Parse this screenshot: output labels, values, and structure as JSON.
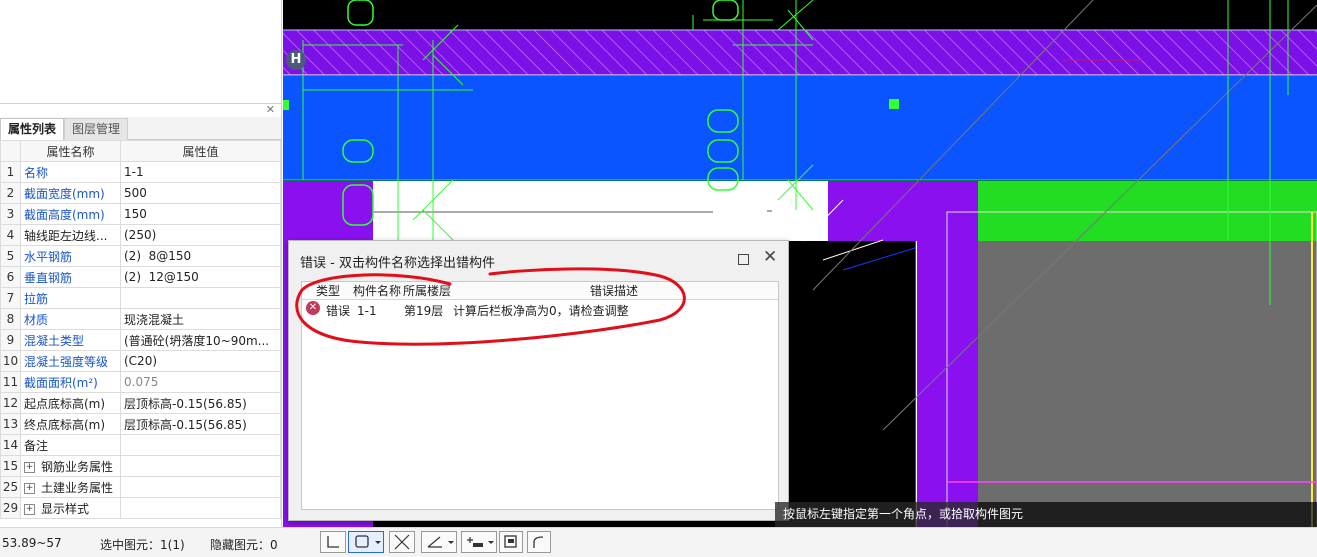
{
  "panel": {
    "tabs": [
      "属性列表",
      "图层管理"
    ],
    "columns": [
      "属性名称",
      "属性值"
    ],
    "rows": [
      {
        "num": "1",
        "name": "名称",
        "value": "1-1",
        "blue": true
      },
      {
        "num": "2",
        "name": "截面宽度(mm)",
        "value": "500",
        "blue": true
      },
      {
        "num": "3",
        "name": "截面高度(mm)",
        "value": "150",
        "blue": true
      },
      {
        "num": "4",
        "name": "轴线距左边线...",
        "value": "(250)",
        "blue": false
      },
      {
        "num": "5",
        "name": "水平钢筋",
        "value": "(2)  8@150",
        "blue": true
      },
      {
        "num": "6",
        "name": "垂直钢筋",
        "value": "(2)  12@150",
        "blue": true
      },
      {
        "num": "7",
        "name": "拉筋",
        "value": "",
        "blue": true
      },
      {
        "num": "8",
        "name": "材质",
        "value": "现浇混凝土",
        "blue": true
      },
      {
        "num": "9",
        "name": "混凝土类型",
        "value": "(普通砼(坍落度10~90m...",
        "blue": true
      },
      {
        "num": "10",
        "name": "混凝土强度等级",
        "value": "(C20)",
        "blue": true
      },
      {
        "num": "11",
        "name": "截面面积(m²)",
        "value": "0.075",
        "blue": true,
        "grayValue": true
      },
      {
        "num": "12",
        "name": "起点底标高(m)",
        "value": "层顶标高-0.15(56.85)",
        "blue": false
      },
      {
        "num": "13",
        "name": "终点底标高(m)",
        "value": "层顶标高-0.15(56.85)",
        "blue": false
      },
      {
        "num": "14",
        "name": "备注",
        "value": "",
        "blue": false
      },
      {
        "num": "15",
        "name": "钢筋业务属性",
        "value": "",
        "blue": false,
        "expander": true
      },
      {
        "num": "25",
        "name": "土建业务属性",
        "value": "",
        "blue": false,
        "expander": true
      },
      {
        "num": "29",
        "name": "显示样式",
        "value": "",
        "blue": false,
        "expander": true
      }
    ]
  },
  "canvas": {
    "marker": "H",
    "hint": "按鼠标左键指定第一个角点，或拾取构件图元"
  },
  "dialog": {
    "title": "错误 - 双击构件名称选择出错构件",
    "headers": {
      "type": "类型",
      "name": "构件名称",
      "floor": "所属楼层",
      "desc": "错误描述"
    },
    "row": {
      "type": "错误",
      "name": "1-1",
      "floor": "第19层",
      "desc": "计算后栏板净高为0，请检查调整"
    }
  },
  "status": {
    "coords": "53.89~57",
    "selected": "选中图元：1(1)",
    "hidden": "隐藏图元：0"
  }
}
